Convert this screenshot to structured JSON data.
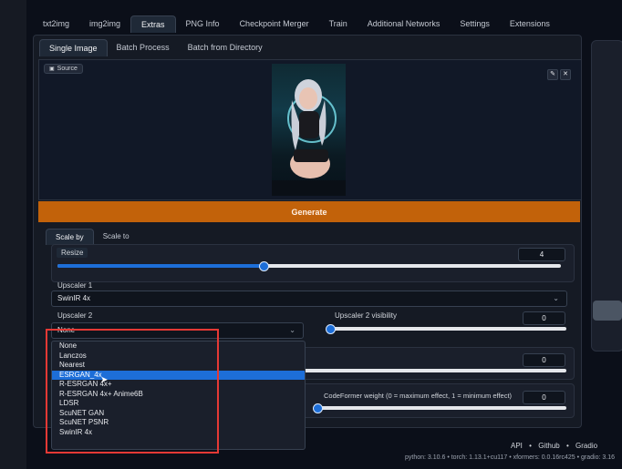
{
  "tabs": [
    "txt2img",
    "img2img",
    "Extras",
    "PNG Info",
    "Checkpoint Merger",
    "Train",
    "Additional Networks",
    "Settings",
    "Extensions"
  ],
  "active_tab_index": 2,
  "subtabs": [
    "Single Image",
    "Batch Process",
    "Batch from Directory"
  ],
  "active_subtab_index": 0,
  "source_label": "Source",
  "generate_label": "Generate",
  "scale_tabs": [
    "Scale by",
    "Scale to"
  ],
  "resize": {
    "label": "Resize",
    "value": "4",
    "fraction": 0.41
  },
  "upscaler1": {
    "label": "Upscaler 1",
    "value": "SwinIR 4x"
  },
  "upscaler2": {
    "label": "Upscaler 2",
    "value": "None"
  },
  "upscaler2_visibility": {
    "label": "Upscaler 2 visibility",
    "value": "0",
    "fraction": 0.0
  },
  "gfpgan_visibility": {
    "value": "0",
    "fraction": 0.0
  },
  "codeformer_weight": {
    "label": "CodeFormer weight (0 = maximum effect, 1 = minimum effect)",
    "value": "0",
    "fraction": 0.0
  },
  "dropdown_options": [
    "None",
    "Lanczos",
    "Nearest",
    "ESRGAN_4x",
    "R-ESRGAN 4x+",
    "R-ESRGAN 4x+ Anime6B",
    "LDSR",
    "ScuNET GAN",
    "ScuNET PSNR",
    "SwinIR 4x"
  ],
  "dropdown_selected_index": 3,
  "footer": {
    "links": [
      "API",
      "Github",
      "Gradio"
    ],
    "separator": "•",
    "info": "python: 3.10.6  •  torch: 1.13.1+cu117  •  xformers: 0.0.16rc425  •  gradio: 3.16"
  },
  "colors": {
    "accent": "#1d6ed8",
    "generate": "#c2620a",
    "highlight": "#e53935"
  },
  "icons": {
    "edit": "pencil-icon",
    "close": "close-icon",
    "source": "image-icon",
    "dropdown": "chevron-down-icon"
  }
}
